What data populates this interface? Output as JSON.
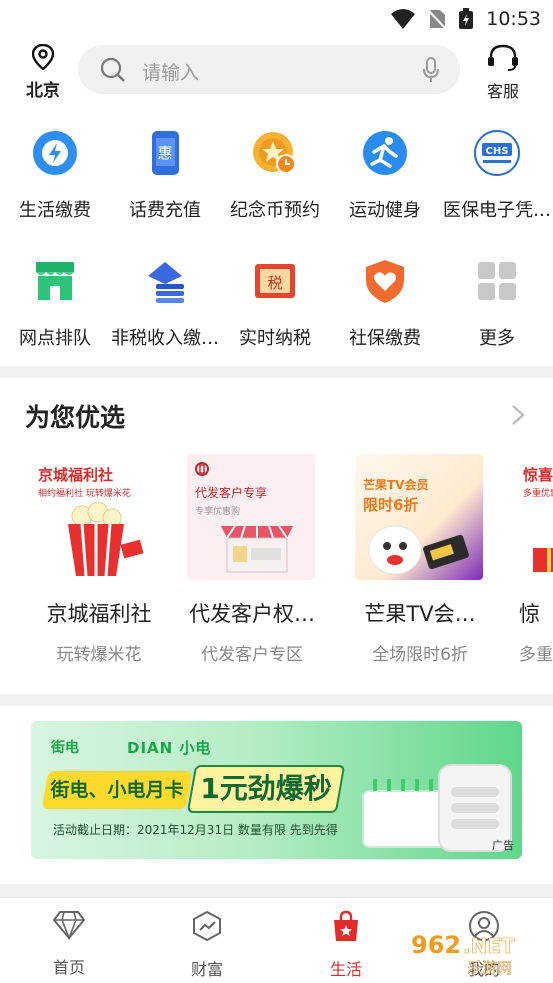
{
  "status_bar": {
    "time": "10:53"
  },
  "header": {
    "location": "北京",
    "search_placeholder": "请输入",
    "service_label": "客服"
  },
  "quick_services": [
    {
      "label": "生活缴费",
      "icon": "lightning-icon"
    },
    {
      "label": "话费充值",
      "icon": "phone-recharge-icon"
    },
    {
      "label": "纪念币预约",
      "icon": "coin-clock-icon"
    },
    {
      "label": "运动健身",
      "icon": "running-icon"
    },
    {
      "label": "医保电子凭…",
      "icon": "chs-badge-icon"
    },
    {
      "label": "网点排队",
      "icon": "branch-store-icon"
    },
    {
      "label": "非税收入缴…",
      "icon": "stack-icon"
    },
    {
      "label": "实时纳税",
      "icon": "tax-icon"
    },
    {
      "label": "社保缴费",
      "icon": "heart-shield-icon"
    },
    {
      "label": "更多",
      "icon": "grid-icon"
    }
  ],
  "recommend": {
    "title": "为您优选",
    "cards": [
      {
        "title": "京城福利社",
        "subtitle": "玩转爆米花",
        "img_title": "京城福利社",
        "img_sub": "相约福利社 玩转爆米花"
      },
      {
        "title": "代发客户权…",
        "subtitle": "代发客户专区",
        "img_title": "代发客户专享",
        "img_sub": "专享优惠购"
      },
      {
        "title": "芒果TV会…",
        "subtitle": "全场限时6折",
        "img_title": "芒果TV会员",
        "img_sub": "限时6折"
      },
      {
        "title": "惊",
        "subtitle": "多重",
        "img_title": "惊喜",
        "img_sub": "多重优惠享"
      }
    ]
  },
  "banner": {
    "brand": "街电",
    "brand2": "DIAN 小电",
    "headline1": "街电、小电月卡",
    "headline2": "1元劲爆秒",
    "note": "活动截止日期：2021年12月31日  数量有限  先到先得",
    "ad_label": "广告",
    "accent": "#1aa64a"
  },
  "tabbar": {
    "tabs": [
      {
        "label": "首页",
        "icon": "diamond-icon",
        "active": false
      },
      {
        "label": "财富",
        "icon": "trend-icon",
        "active": false
      },
      {
        "label": "生活",
        "icon": "shopping-bag-icon",
        "active": true
      },
      {
        "label": "我的",
        "icon": "person-icon",
        "active": false
      }
    ],
    "active_color": "#e32b2b"
  },
  "watermark": "962.NET 乐游网"
}
